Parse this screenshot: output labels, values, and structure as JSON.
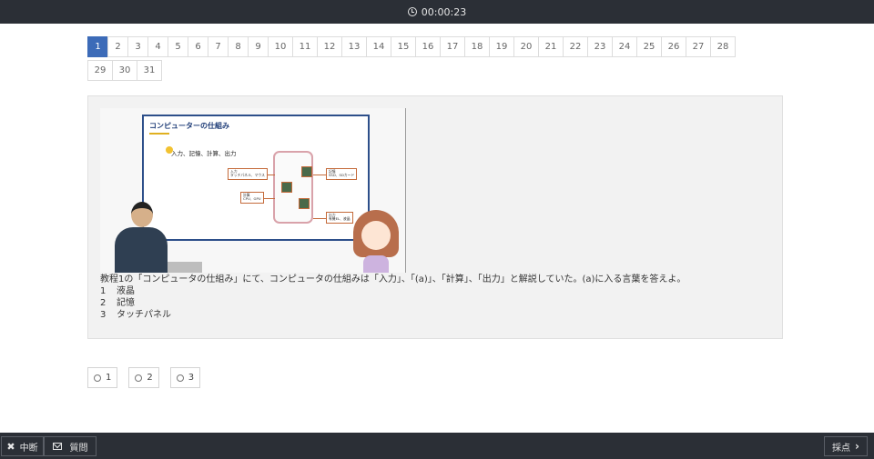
{
  "timer": {
    "elapsed": "00:00:23"
  },
  "pager": {
    "current": "1",
    "pages": [
      "1",
      "2",
      "3",
      "4",
      "5",
      "6",
      "7",
      "8",
      "9",
      "10",
      "11",
      "12",
      "13",
      "14",
      "15",
      "16",
      "17",
      "18",
      "19",
      "20",
      "21",
      "22",
      "23",
      "24",
      "25",
      "26",
      "27",
      "28",
      "29",
      "30",
      "31"
    ]
  },
  "figure": {
    "slide_title": "コンピューターの仕組み",
    "bullet": "入力、記憶、計算、出力",
    "labels": {
      "input": [
        "入力",
        "タッチパネル、マウス"
      ],
      "memory": [
        "記憶",
        "SSD、SDカード"
      ],
      "compute": [
        "計算",
        "CPU、GPU"
      ],
      "output": [
        "出力",
        "有機EL、液晶"
      ]
    }
  },
  "question": {
    "text": "教程1の「コンピュータの仕組み」にて、コンピュータの仕組みは「入力」、「(a)」、「計算」、「出力」と解説していた。(a)に入る言葉を答えよ。",
    "options": [
      {
        "num": "1",
        "text": "液晶"
      },
      {
        "num": "2",
        "text": "記憶"
      },
      {
        "num": "3",
        "text": "タッチパネル"
      }
    ]
  },
  "answers": [
    "1",
    "2",
    "3"
  ],
  "footer": {
    "suspend_label": "中断",
    "question_label": "質問",
    "grade_label": "採点"
  },
  "colors": {
    "accent": "#3c6bb8",
    "bar": "#2b2f36"
  },
  "icons": [
    "clock-icon",
    "x-icon",
    "mail-icon",
    "chevron-right-icon",
    "radio-icon"
  ]
}
